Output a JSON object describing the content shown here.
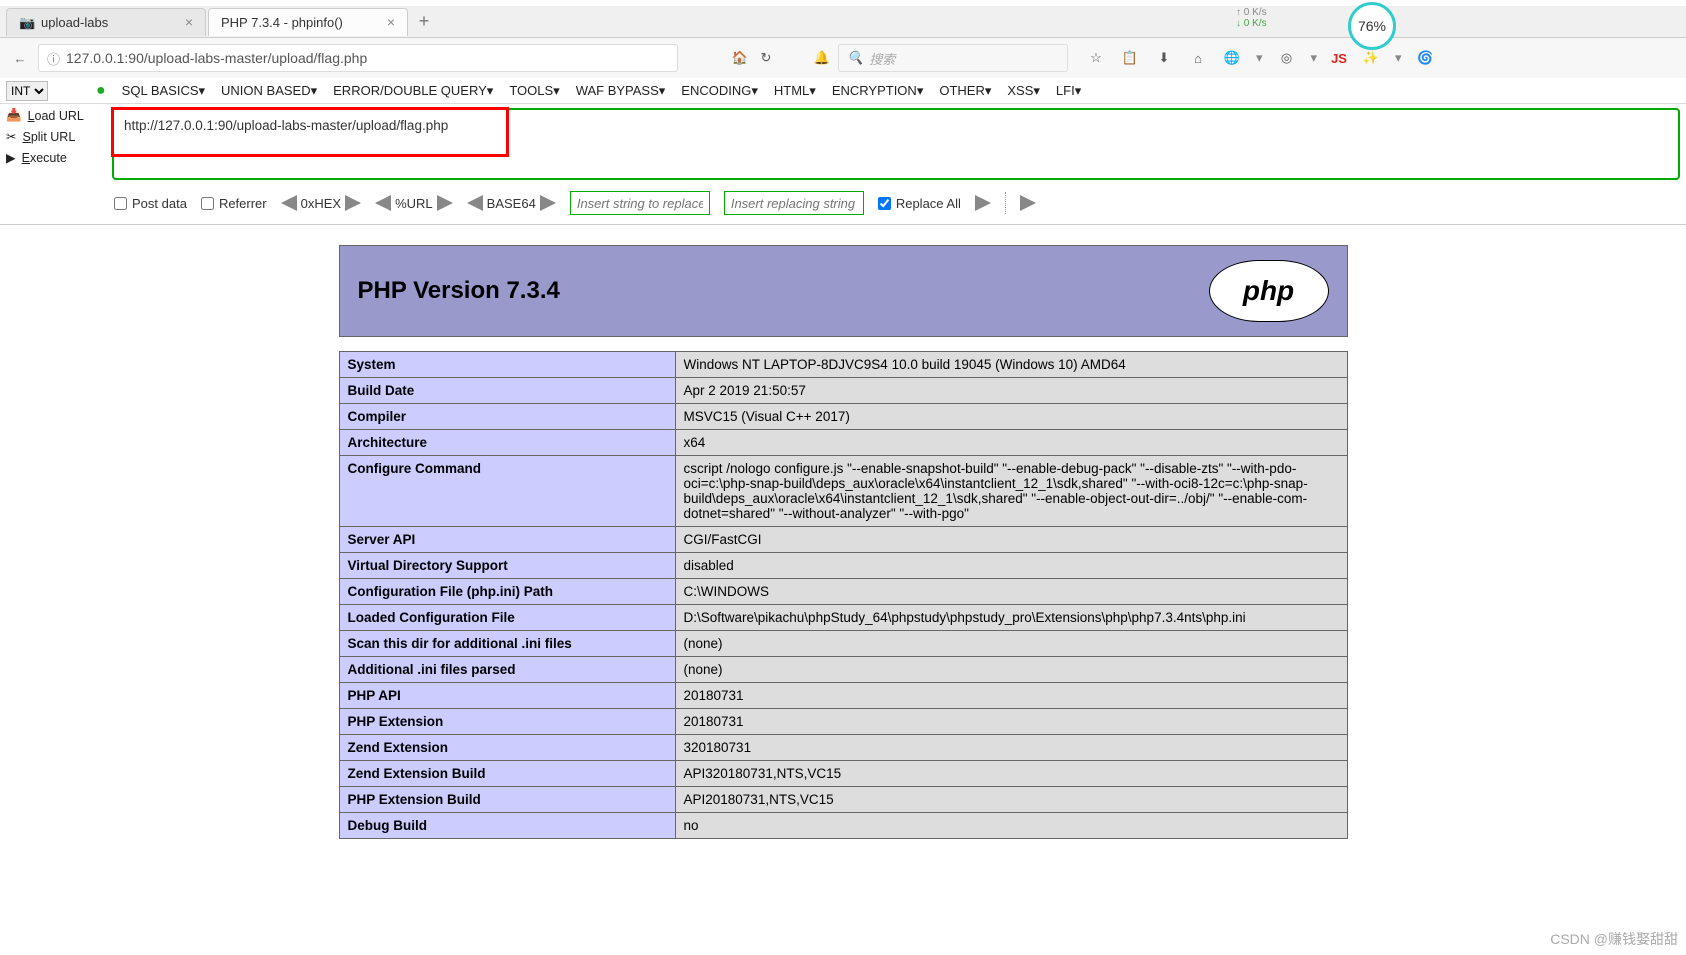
{
  "tabs": [
    {
      "title": "upload-labs"
    },
    {
      "title": "PHP 7.3.4 - phpinfo()"
    }
  ],
  "new_tab_glyph": "+",
  "address_bar": {
    "info_glyph": "ⓘ",
    "url": "127.0.0.1:90/upload-labs-master/upload/flag.php"
  },
  "search_placeholder": "搜索",
  "toolbar_icons": {
    "back": "←",
    "home": "🏠",
    "reload": "↻",
    "bell": "🔔",
    "star": "☆",
    "clipboard": "📋",
    "download": "⬇",
    "home2": "⌂",
    "globe": "🌐",
    "target": "◎",
    "js": "JS",
    "wand": "✨",
    "swirl": "🌀"
  },
  "speed": {
    "up": "↑ 0  K/s",
    "down": "↓ 0  K/s",
    "pct": "76%"
  },
  "hackbar": {
    "select_int": "INT",
    "menu": [
      "SQL BASICS",
      "UNION BASED",
      "ERROR/DOUBLE QUERY",
      "TOOLS",
      "WAF BYPASS",
      "ENCODING",
      "HTML",
      "ENCRYPTION",
      "OTHER",
      "XSS",
      "LFI"
    ],
    "side": [
      {
        "icon": "📥",
        "label": "Load URL",
        "u": "L"
      },
      {
        "icon": "✂",
        "label": "Split URL",
        "u": "S"
      },
      {
        "icon": "▶",
        "label": "Execute",
        "u": "E"
      }
    ],
    "url_value": "http://127.0.0.1:90/upload-labs-master/upload/flag.php",
    "opts": {
      "post": "Post data",
      "referrer": "Referrer",
      "hex": "0xHEX",
      "urlenc": "%URL",
      "b64": "BASE64",
      "ins1": "Insert string to replace",
      "ins2": "Insert replacing string",
      "replace": "Replace All"
    }
  },
  "phpinfo": {
    "title": "PHP Version 7.3.4",
    "logo": "php",
    "rows": [
      [
        "System",
        "Windows NT LAPTOP-8DJVC9S4 10.0 build 19045 (Windows 10) AMD64"
      ],
      [
        "Build Date",
        "Apr 2 2019 21:50:57"
      ],
      [
        "Compiler",
        "MSVC15 (Visual C++ 2017)"
      ],
      [
        "Architecture",
        "x64"
      ],
      [
        "Configure Command",
        "cscript /nologo configure.js \"--enable-snapshot-build\" \"--enable-debug-pack\" \"--disable-zts\" \"--with-pdo-oci=c:\\php-snap-build\\deps_aux\\oracle\\x64\\instantclient_12_1\\sdk,shared\" \"--with-oci8-12c=c:\\php-snap-build\\deps_aux\\oracle\\x64\\instantclient_12_1\\sdk,shared\" \"--enable-object-out-dir=../obj/\" \"--enable-com-dotnet=shared\" \"--without-analyzer\" \"--with-pgo\""
      ],
      [
        "Server API",
        "CGI/FastCGI"
      ],
      [
        "Virtual Directory Support",
        "disabled"
      ],
      [
        "Configuration File (php.ini) Path",
        "C:\\WINDOWS"
      ],
      [
        "Loaded Configuration File",
        "D:\\Software\\pikachu\\phpStudy_64\\phpstudy\\phpstudy_pro\\Extensions\\php\\php7.3.4nts\\php.ini"
      ],
      [
        "Scan this dir for additional .ini files",
        "(none)"
      ],
      [
        "Additional .ini files parsed",
        "(none)"
      ],
      [
        "PHP API",
        "20180731"
      ],
      [
        "PHP Extension",
        "20180731"
      ],
      [
        "Zend Extension",
        "320180731"
      ],
      [
        "Zend Extension Build",
        "API320180731,NTS,VC15"
      ],
      [
        "PHP Extension Build",
        "API20180731,NTS,VC15"
      ],
      [
        "Debug Build",
        "no"
      ]
    ]
  },
  "watermark": "CSDN @赚钱娶甜甜"
}
